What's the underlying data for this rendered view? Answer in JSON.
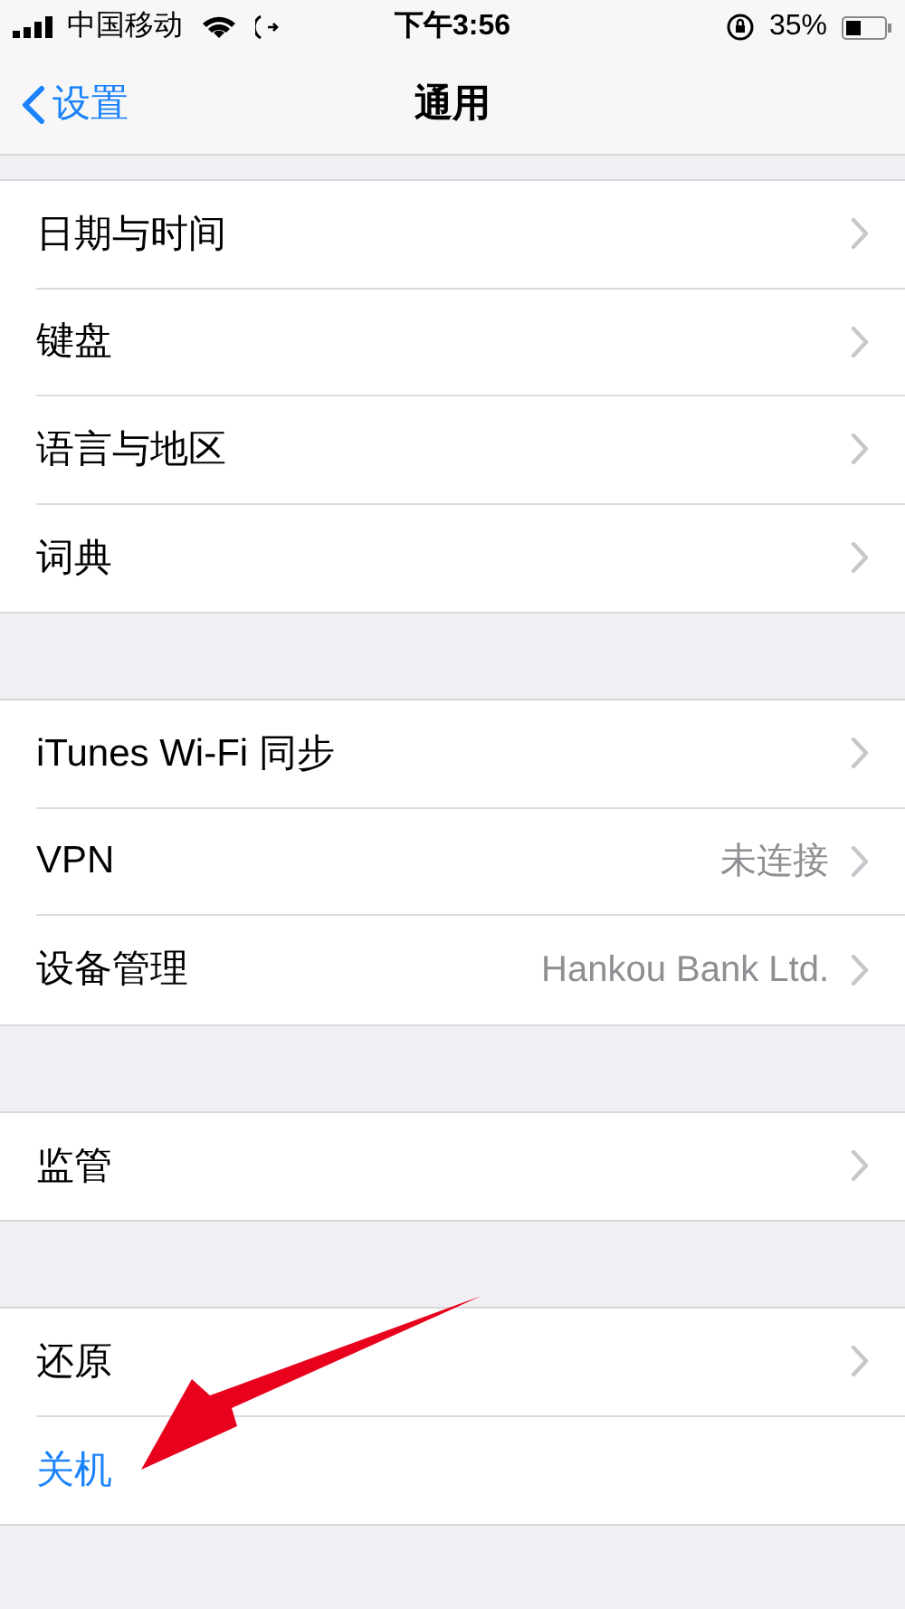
{
  "status_bar": {
    "carrier": "中国移动",
    "time": "下午3:56",
    "battery": "35%"
  },
  "nav": {
    "back": "设置",
    "title": "通用"
  },
  "groups": [
    {
      "rows": [
        {
          "label": "日期与时间",
          "kind": "link"
        },
        {
          "label": "键盘",
          "kind": "link"
        },
        {
          "label": "语言与地区",
          "kind": "link"
        },
        {
          "label": "词典",
          "kind": "link"
        }
      ]
    },
    {
      "rows": [
        {
          "label": "iTunes Wi-Fi 同步",
          "kind": "link"
        },
        {
          "label": "VPN",
          "kind": "link",
          "detail": "未连接"
        },
        {
          "label": "设备管理",
          "kind": "link",
          "detail": "Hankou Bank Ltd."
        }
      ]
    },
    {
      "rows": [
        {
          "label": "监管",
          "kind": "link"
        }
      ]
    },
    {
      "rows": [
        {
          "label": "还原",
          "kind": "link"
        },
        {
          "label": "关机",
          "kind": "action"
        }
      ]
    }
  ]
}
